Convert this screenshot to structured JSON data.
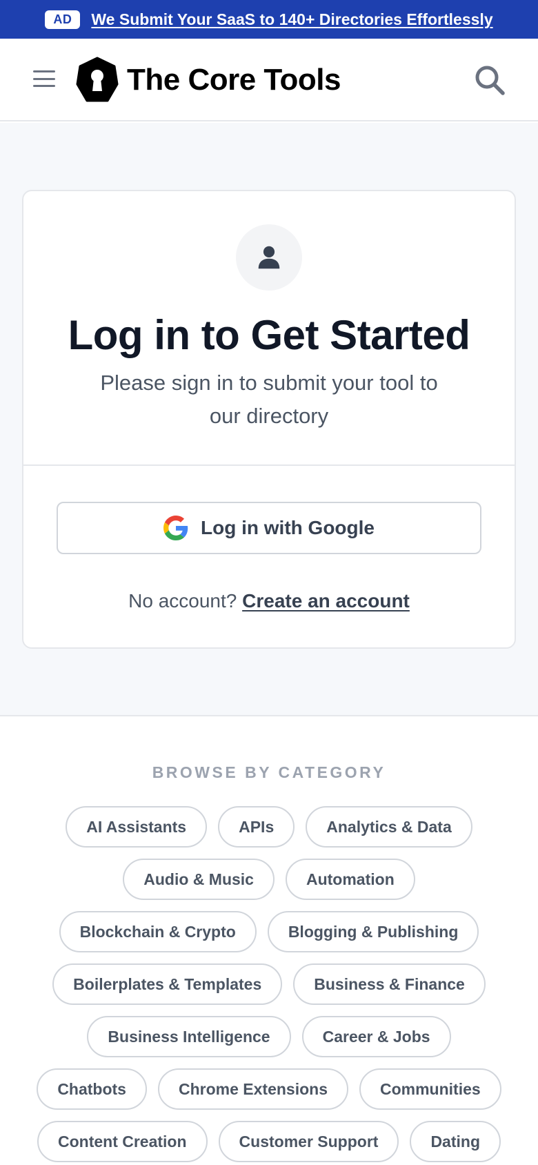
{
  "ad_banner": {
    "badge": "AD",
    "link_text": "We Submit Your SaaS to 140+ Directories Effortlessly"
  },
  "header": {
    "logo_text": "The Core Tools",
    "icons": {
      "menu": "hamburger-menu-icon",
      "logo": "keyhole-logo-icon",
      "search": "search-icon"
    }
  },
  "login": {
    "avatar_icon": "user-icon",
    "title": "Log in to Get Started",
    "subtitle": "Please sign in to submit your tool to our directory",
    "google_button": "Log in with Google",
    "no_account_text": "No account?",
    "create_account_link": "Create an account"
  },
  "categories": {
    "heading": "BROWSE BY CATEGORY",
    "items": [
      "AI Assistants",
      "APIs",
      "Analytics & Data",
      "Audio & Music",
      "Automation",
      "Blockchain & Crypto",
      "Blogging & Publishing",
      "Boilerplates & Templates",
      "Business & Finance",
      "Business Intelligence",
      "Career & Jobs",
      "Chatbots",
      "Chrome Extensions",
      "Communities",
      "Content Creation",
      "Customer Support",
      "Dating"
    ]
  },
  "colors": {
    "ad_background": "#1e40af",
    "page_background": "#f6f8fb",
    "text_dark": "#111827",
    "text_muted": "#4b5563",
    "border": "#d1d5db"
  }
}
